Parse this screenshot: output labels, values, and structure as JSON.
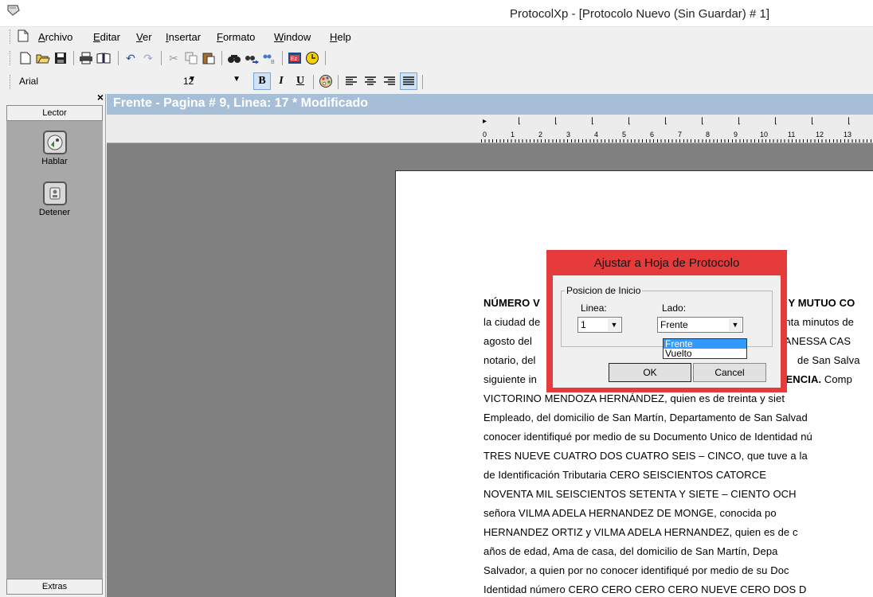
{
  "window": {
    "title": "ProtocolXp - [Protocolo Nuevo (Sin Guardar) # 1]"
  },
  "menu": [
    "Archivo",
    "Editar",
    "Ver",
    "Insertar",
    "Formato",
    "Window",
    "Help"
  ],
  "toolbar": {
    "icons": [
      "new-icon",
      "open-icon",
      "save-icon",
      "print-icon",
      "preview-icon",
      "undo-icon",
      "redo-icon",
      "cut-icon",
      "copy-icon",
      "paste-icon",
      "find-icon",
      "find-next-icon",
      "replace-icon",
      "insert-icon",
      "clock-icon"
    ]
  },
  "format": {
    "font": "Arial",
    "size": "12",
    "bold": "B",
    "italic": "I",
    "underline": "U",
    "active": "justify"
  },
  "lector": {
    "tab_top": "Lector",
    "hablar": "Hablar",
    "detener": "Detener",
    "tab_bottom": "Extras"
  },
  "status": {
    "text": "Frente - Pagina # 9,  Linea:  17   * Modificado"
  },
  "ruler": {
    "numbers": [
      "0",
      "1",
      "2",
      "3",
      "4",
      "5",
      "6",
      "7",
      "8",
      "9",
      "10",
      "11",
      "12",
      "13"
    ]
  },
  "document": {
    "lines": [
      {
        "text": "NÚMERO V",
        "bold": true
      },
      {
        "text": "la ciudad de"
      },
      {
        "text": "agosto del"
      },
      {
        "text": "notario, del"
      },
      {
        "text": "siguiente in"
      },
      {
        "text": "VICTORINO MENDOZA HERNÁNDEZ, quien es de treinta y siet"
      },
      {
        "text": "Empleado, del domicilio de San Martín, Departamento de San Salvad"
      },
      {
        "text": "conocer identifiqué por medio de su Documento Unico de Identidad nú"
      },
      {
        "text": "TRES NUEVE CUATRO DOS CUATRO SEIS – CINCO, que tuve a la"
      },
      {
        "text": "de  Identificación  Tributaria  CERO  SEISCIENTOS  CATORCE"
      },
      {
        "text": "NOVENTA MIL SEISCIENTOS SETENTA Y SIETE – CIENTO OCH"
      },
      {
        "text": "señora  VILMA  ADELA  HERNANDEZ  DE  MONGE,  conocida  po"
      },
      {
        "text": "HERNANDEZ ORTIZ y VILMA ADELA HERNANDEZ, quien es de c"
      },
      {
        "text": "años de edad, Ama de casa, del domicilio de San Martín, Depa"
      },
      {
        "text": "Salvador, a quien por no conocer identifiqué por medio de su Doc"
      },
      {
        "text": "Identidad número CERO CERO CERO CERO NUEVE CERO DOS D"
      }
    ],
    "right_fragments": [
      {
        "text": "A Y MUTUO CO",
        "bold": true
      },
      {
        "text": "enta minutos de"
      },
      {
        "text": "VANESSA CAS"
      },
      {
        "text": "de San Salva"
      },
      {
        "text": "CENCIA.",
        "bold": true,
        "after": " Comp"
      }
    ]
  },
  "dialog": {
    "title": "Ajustar a Hoja de Protocolo",
    "group": "Posicion de Inicio",
    "linea_label": "Linea:",
    "linea_value": "1",
    "lado_label": "Lado:",
    "lado_value": "Frente",
    "options": [
      "Frente",
      "Vuelto"
    ],
    "ok": "OK",
    "cancel": "Cancel"
  }
}
